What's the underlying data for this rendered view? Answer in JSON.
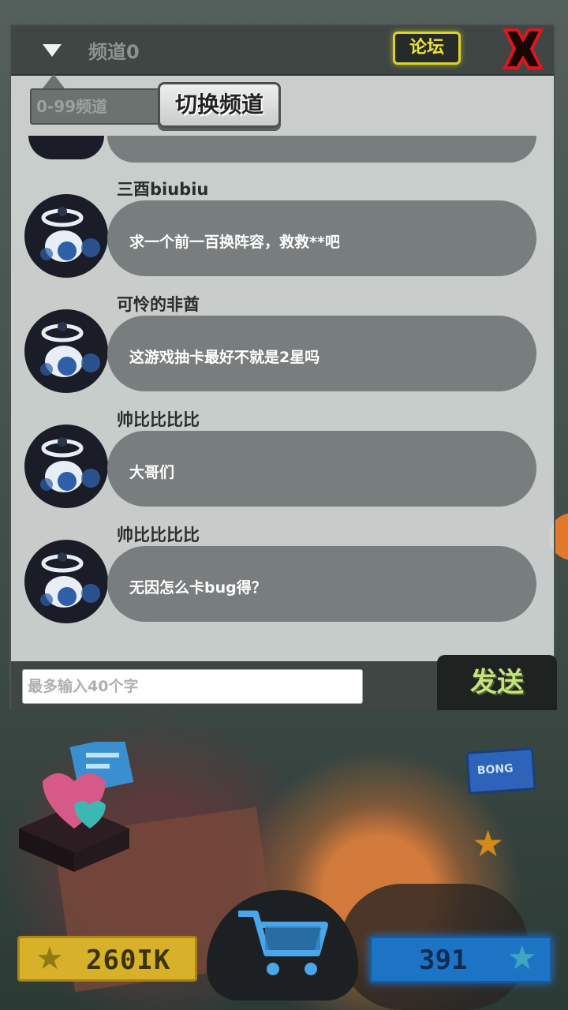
{
  "header": {
    "channel_name": "频道0",
    "forum_label": "论坛",
    "channel_range": "0-99频道",
    "switch_label": "切换频道"
  },
  "messages": [
    {
      "name": "三酉biubiu",
      "text": "求一个前一百换阵容，救救**吧"
    },
    {
      "name": "可怜的非酋",
      "text": "这游戏抽卡最好不就是2星吗"
    },
    {
      "name": "帅比比比比",
      "text": "大哥们"
    },
    {
      "name": "帅比比比比",
      "text": "无因怎么卡bug得？"
    }
  ],
  "input": {
    "placeholder": "最多输入40个字",
    "send_label": "发送"
  },
  "hud": {
    "coins": "260IK",
    "gems": "391",
    "ticket_label": "BONG"
  },
  "colors": {
    "forum_accent": "#e8e23a",
    "close_red": "#d8141c",
    "coin_bar": "#d7b12a",
    "gem_bar": "#1e74c4",
    "send_text": "#c6e27a"
  }
}
